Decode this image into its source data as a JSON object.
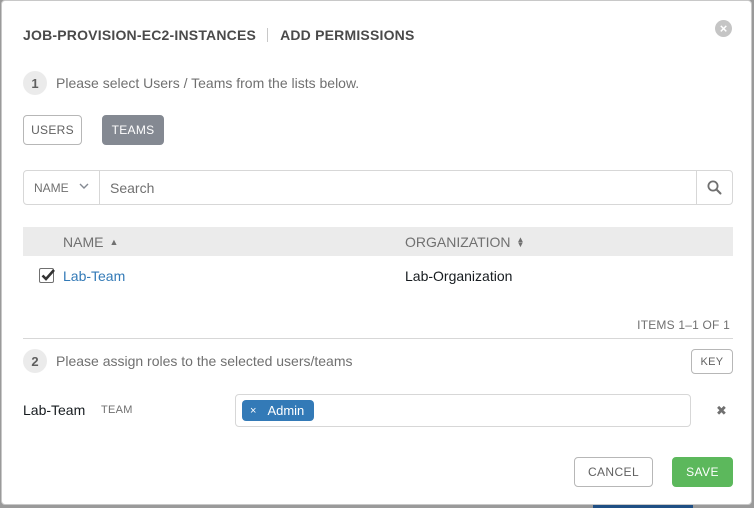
{
  "header": {
    "resource": "JOB-PROVISION-EC2-INSTANCES",
    "title": "ADD PERMISSIONS"
  },
  "close_icon": "×",
  "step1": {
    "number": "1",
    "text": "Please select Users / Teams from the lists below."
  },
  "toggle": {
    "users": "USERS",
    "teams": "TEAMS",
    "active": "teams"
  },
  "search": {
    "field": "NAME",
    "placeholder": "Search"
  },
  "table": {
    "columns": [
      "NAME",
      "ORGANIZATION"
    ],
    "rows": [
      {
        "checked": true,
        "name": "Lab-Team",
        "organization": "Lab-Organization"
      }
    ],
    "pagination": "ITEMS 1–1 OF 1"
  },
  "step2": {
    "number": "2",
    "text": "Please assign roles to the selected users/teams",
    "key_label": "KEY"
  },
  "assignment": {
    "name": "Lab-Team",
    "type": "TEAM",
    "roles": [
      "Admin"
    ],
    "chip_remove": "×",
    "remove_icon": "✖"
  },
  "footer": {
    "cancel": "CANCEL",
    "save": "SAVE"
  },
  "colors": {
    "primary": "#337ab7",
    "success": "#5cb85c",
    "active_toggle": "#848992"
  }
}
